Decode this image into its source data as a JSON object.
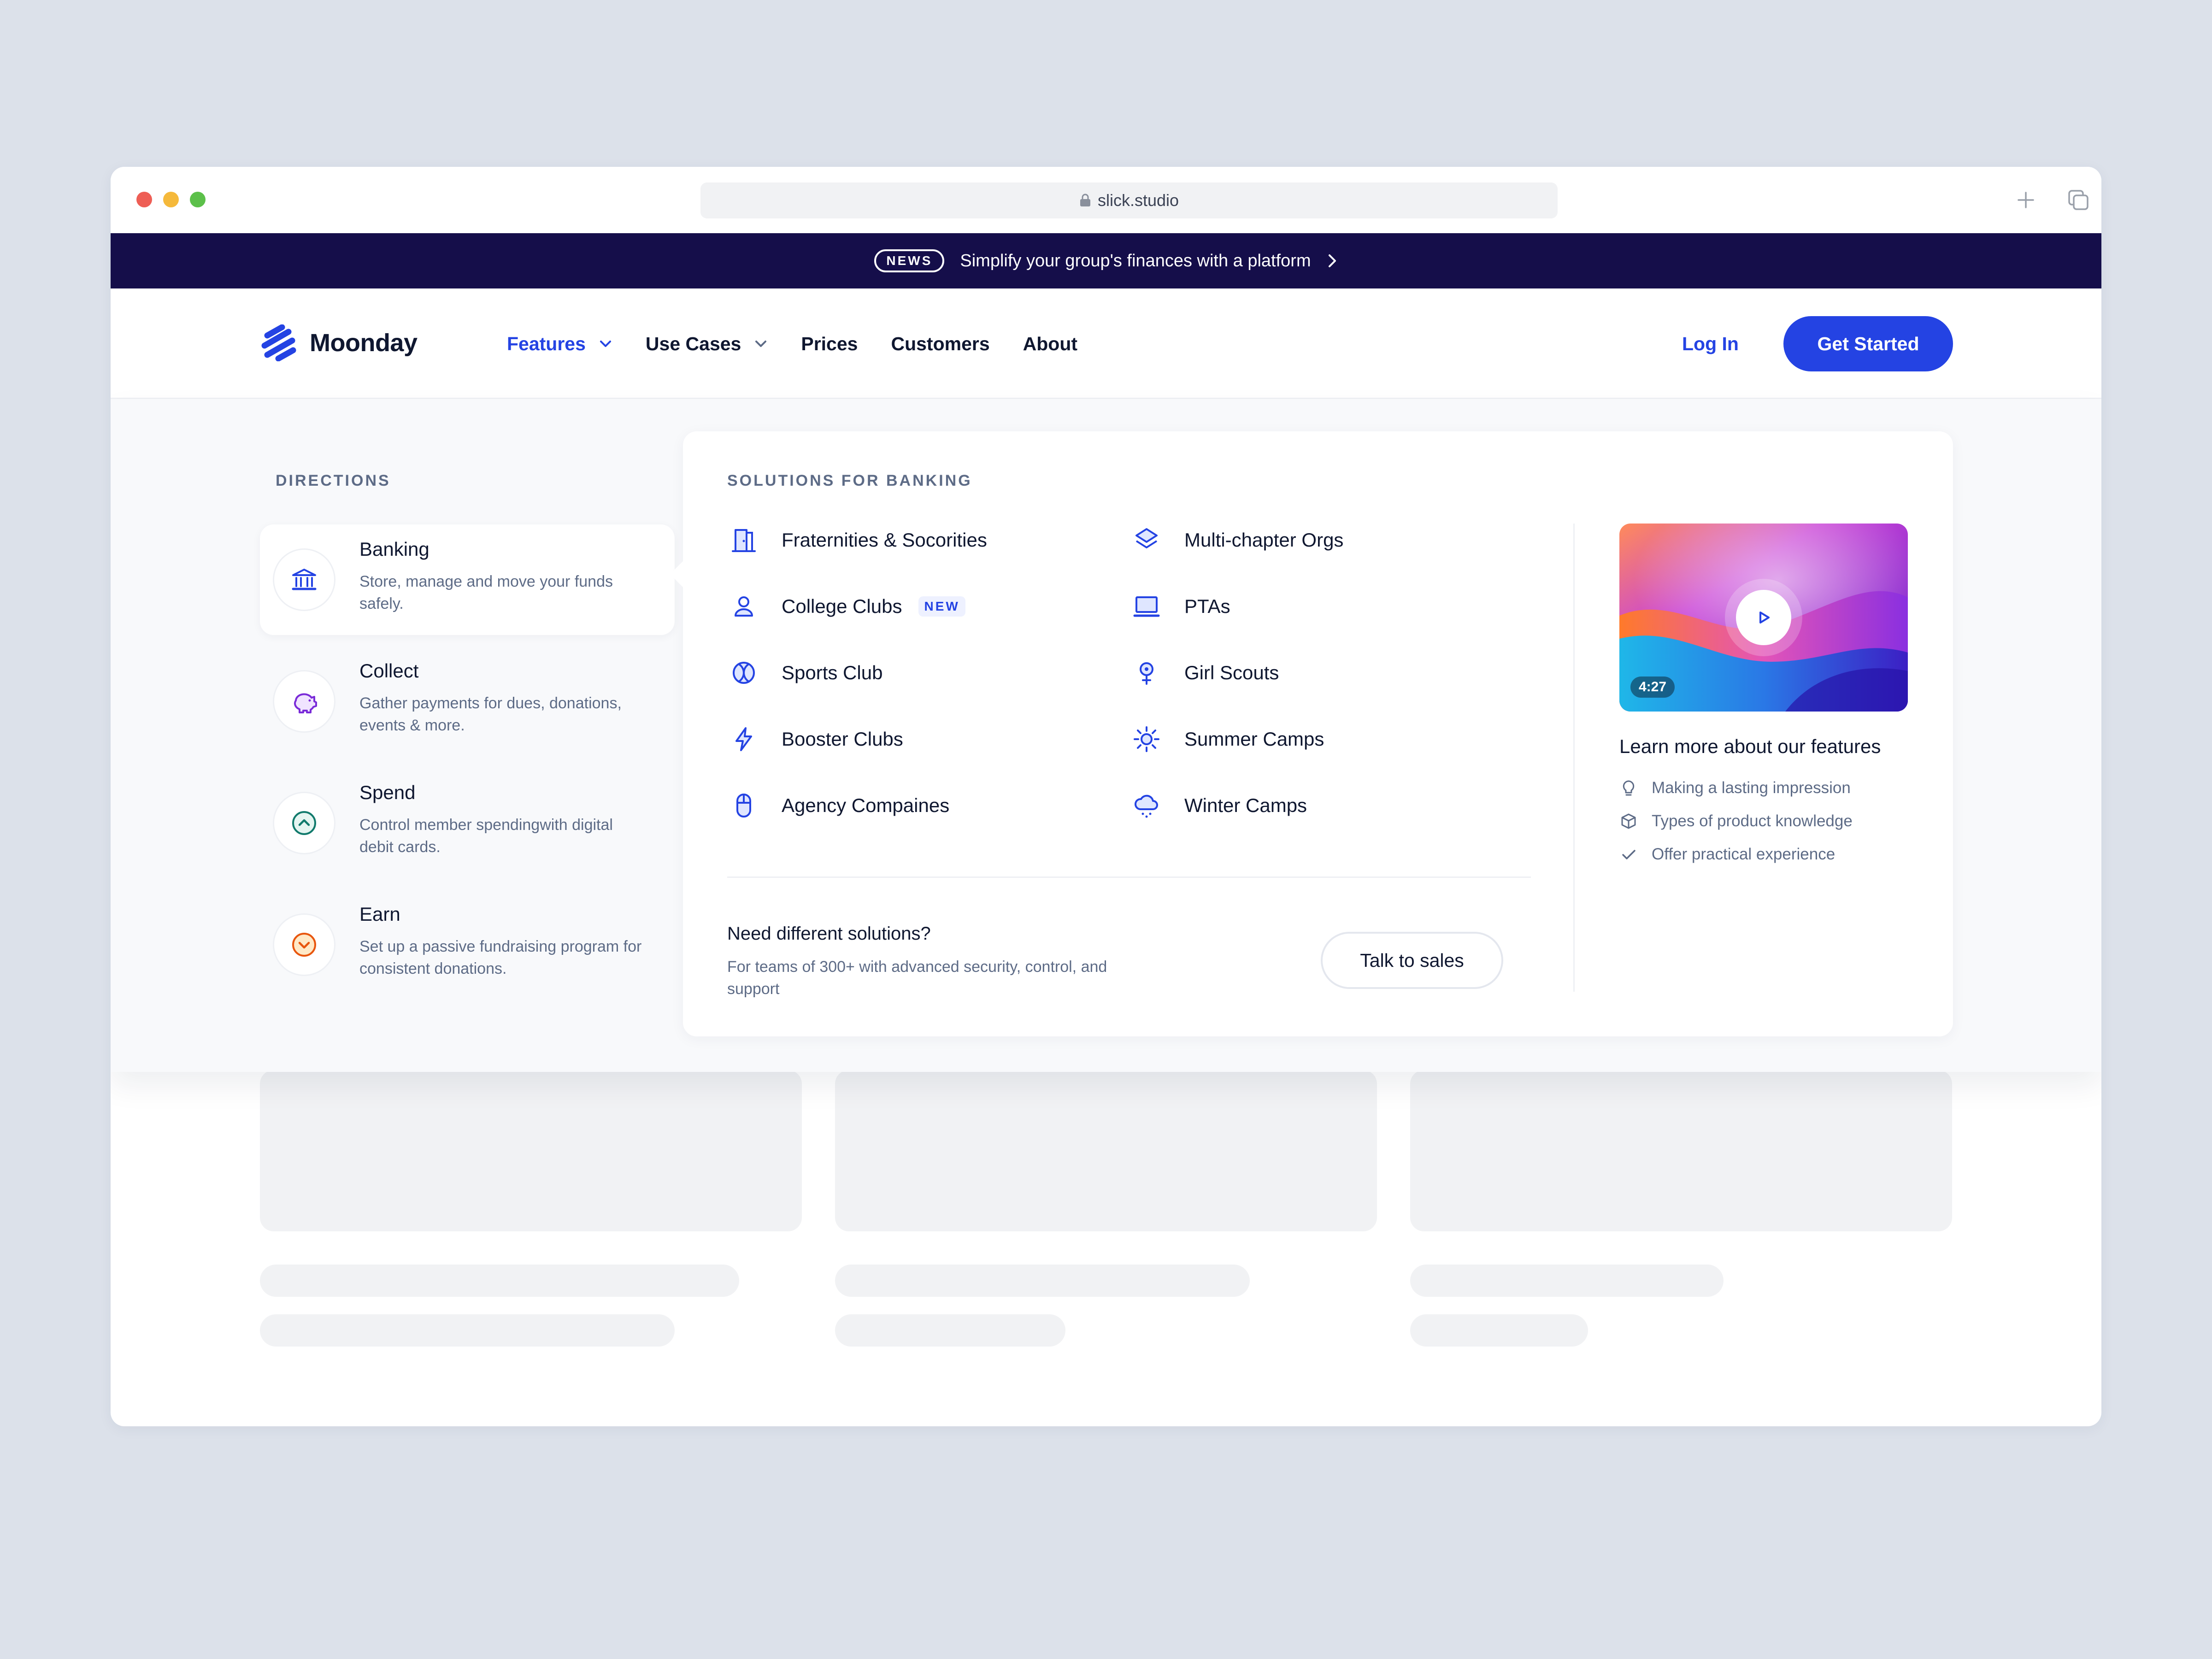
{
  "browser": {
    "url": "slick.studio"
  },
  "news": {
    "badge": "NEWS",
    "text": "Simplify your group's finances with a platform"
  },
  "header": {
    "logo_text": "Moonday",
    "nav": [
      {
        "label": "Features",
        "active": true,
        "dropdown": true
      },
      {
        "label": "Use Cases",
        "active": false,
        "dropdown": true
      },
      {
        "label": "Prices",
        "active": false,
        "dropdown": false
      },
      {
        "label": "Customers",
        "active": false,
        "dropdown": false
      },
      {
        "label": "About",
        "active": false,
        "dropdown": false
      }
    ],
    "login": "Log In",
    "cta": "Get Started"
  },
  "directions": {
    "title": "DIRECTIONS",
    "items": [
      {
        "label": "Banking",
        "desc": "Store, manage and  move your funds safely.",
        "icon": "bank-icon",
        "active": true
      },
      {
        "label": "Collect",
        "desc": "Gather payments for dues, donations, events & more.",
        "icon": "piggy-bank-icon",
        "active": false
      },
      {
        "label": "Spend",
        "desc": "Control member spendingwith digital debit cards.",
        "icon": "arrow-up-circle-icon",
        "active": false
      },
      {
        "label": "Earn",
        "desc": "Set up a passive fundraising program for consistent donations.",
        "icon": "arrow-down-circle-icon",
        "active": false
      }
    ]
  },
  "solutions": {
    "title": "SOLUTIONS FOR BANKING",
    "items": [
      {
        "label": "Fraternities & Socorities",
        "icon": "building-door-icon"
      },
      {
        "label": "College Clubs",
        "icon": "user-icon",
        "badge": "NEW"
      },
      {
        "label": "Sports Club",
        "icon": "ball-icon"
      },
      {
        "label": "Booster Clubs",
        "icon": "lightning-icon"
      },
      {
        "label": "Agency Compaines",
        "icon": "mouse-icon"
      },
      {
        "label": "Multi-chapter Orgs",
        "icon": "layers-icon"
      },
      {
        "label": "PTAs",
        "icon": "laptop-icon"
      },
      {
        "label": "Girl Scouts",
        "icon": "location-pin-icon"
      },
      {
        "label": "Summer Camps",
        "icon": "sun-icon"
      },
      {
        "label": "Winter Camps",
        "icon": "snow-cloud-icon"
      }
    ],
    "need_title": "Need different solutions?",
    "need_desc": "For teams of 300+ with advanced security, control, and support",
    "talk_button": "Talk to sales"
  },
  "video": {
    "duration": "4:27",
    "learn_title": "Learn more about our features",
    "points": [
      {
        "label": "Making a lasting impression",
        "icon": "lightbulb-icon"
      },
      {
        "label": "Types of product knowledge",
        "icon": "cube-icon"
      },
      {
        "label": "Offer practical experience",
        "icon": "check-icon"
      }
    ]
  },
  "colors": {
    "accent": "#2443e3",
    "news_bg": "#150e4a",
    "muted_text": "#5d6b86"
  }
}
